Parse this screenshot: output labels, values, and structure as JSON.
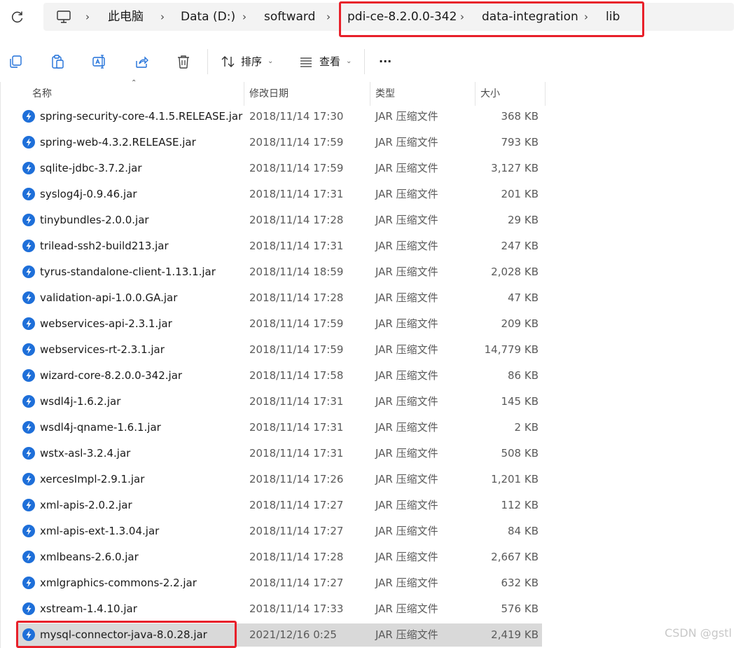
{
  "breadcrumb": {
    "items": [
      "此电脑",
      "Data (D:)",
      "softward",
      "pdi-ce-8.2.0.0-342",
      "data-integration",
      "lib"
    ],
    "separator": "›"
  },
  "toolbar": {
    "sort_label": "排序",
    "view_label": "查看",
    "more_label": "···"
  },
  "columns": {
    "name": "名称",
    "modified": "修改日期",
    "type": "类型",
    "size": "大小"
  },
  "files": [
    {
      "name": "spring-security-core-4.1.5.RELEASE.jar",
      "modified": "2018/11/14 17:30",
      "type": "JAR 压缩文件",
      "size": "368 KB"
    },
    {
      "name": "spring-web-4.3.2.RELEASE.jar",
      "modified": "2018/11/14 17:59",
      "type": "JAR 压缩文件",
      "size": "793 KB"
    },
    {
      "name": "sqlite-jdbc-3.7.2.jar",
      "modified": "2018/11/14 17:59",
      "type": "JAR 压缩文件",
      "size": "3,127 KB"
    },
    {
      "name": "syslog4j-0.9.46.jar",
      "modified": "2018/11/14 17:31",
      "type": "JAR 压缩文件",
      "size": "201 KB"
    },
    {
      "name": "tinybundles-2.0.0.jar",
      "modified": "2018/11/14 17:28",
      "type": "JAR 压缩文件",
      "size": "29 KB"
    },
    {
      "name": "trilead-ssh2-build213.jar",
      "modified": "2018/11/14 17:31",
      "type": "JAR 压缩文件",
      "size": "247 KB"
    },
    {
      "name": "tyrus-standalone-client-1.13.1.jar",
      "modified": "2018/11/14 18:59",
      "type": "JAR 压缩文件",
      "size": "2,028 KB"
    },
    {
      "name": "validation-api-1.0.0.GA.jar",
      "modified": "2018/11/14 17:28",
      "type": "JAR 压缩文件",
      "size": "47 KB"
    },
    {
      "name": "webservices-api-2.3.1.jar",
      "modified": "2018/11/14 17:59",
      "type": "JAR 压缩文件",
      "size": "209 KB"
    },
    {
      "name": "webservices-rt-2.3.1.jar",
      "modified": "2018/11/14 17:59",
      "type": "JAR 压缩文件",
      "size": "14,779 KB"
    },
    {
      "name": "wizard-core-8.2.0.0-342.jar",
      "modified": "2018/11/14 17:58",
      "type": "JAR 压缩文件",
      "size": "86 KB"
    },
    {
      "name": "wsdl4j-1.6.2.jar",
      "modified": "2018/11/14 17:31",
      "type": "JAR 压缩文件",
      "size": "145 KB"
    },
    {
      "name": "wsdl4j-qname-1.6.1.jar",
      "modified": "2018/11/14 17:31",
      "type": "JAR 压缩文件",
      "size": "2 KB"
    },
    {
      "name": "wstx-asl-3.2.4.jar",
      "modified": "2018/11/14 17:31",
      "type": "JAR 压缩文件",
      "size": "508 KB"
    },
    {
      "name": "xercesImpl-2.9.1.jar",
      "modified": "2018/11/14 17:26",
      "type": "JAR 压缩文件",
      "size": "1,201 KB"
    },
    {
      "name": "xml-apis-2.0.2.jar",
      "modified": "2018/11/14 17:27",
      "type": "JAR 压缩文件",
      "size": "112 KB"
    },
    {
      "name": "xml-apis-ext-1.3.04.jar",
      "modified": "2018/11/14 17:27",
      "type": "JAR 压缩文件",
      "size": "84 KB"
    },
    {
      "name": "xmlbeans-2.6.0.jar",
      "modified": "2018/11/14 17:28",
      "type": "JAR 压缩文件",
      "size": "2,667 KB"
    },
    {
      "name": "xmlgraphics-commons-2.2.jar",
      "modified": "2018/11/14 17:27",
      "type": "JAR 压缩文件",
      "size": "632 KB"
    },
    {
      "name": "xstream-1.4.10.jar",
      "modified": "2018/11/14 17:33",
      "type": "JAR 压缩文件",
      "size": "576 KB"
    },
    {
      "name": "mysql-connector-java-8.0.28.jar",
      "modified": "2021/12/16 0:25",
      "type": "JAR 压缩文件",
      "size": "2,419 KB",
      "selected": true
    }
  ],
  "watermark": "CSDN @gstl",
  "colors": {
    "highlight_border": "#e8202a",
    "file_icon": "#1e6fd9",
    "selected_row": "#d9d9d9"
  },
  "icons": {
    "refresh": "refresh-icon",
    "computer": "computer-icon",
    "copy": "copy-icon",
    "paste": "paste-icon",
    "rename": "rename-icon",
    "share": "share-icon",
    "delete": "trash-icon",
    "sort": "sort-icon",
    "view": "view-icon",
    "file": "jar-file-icon"
  }
}
